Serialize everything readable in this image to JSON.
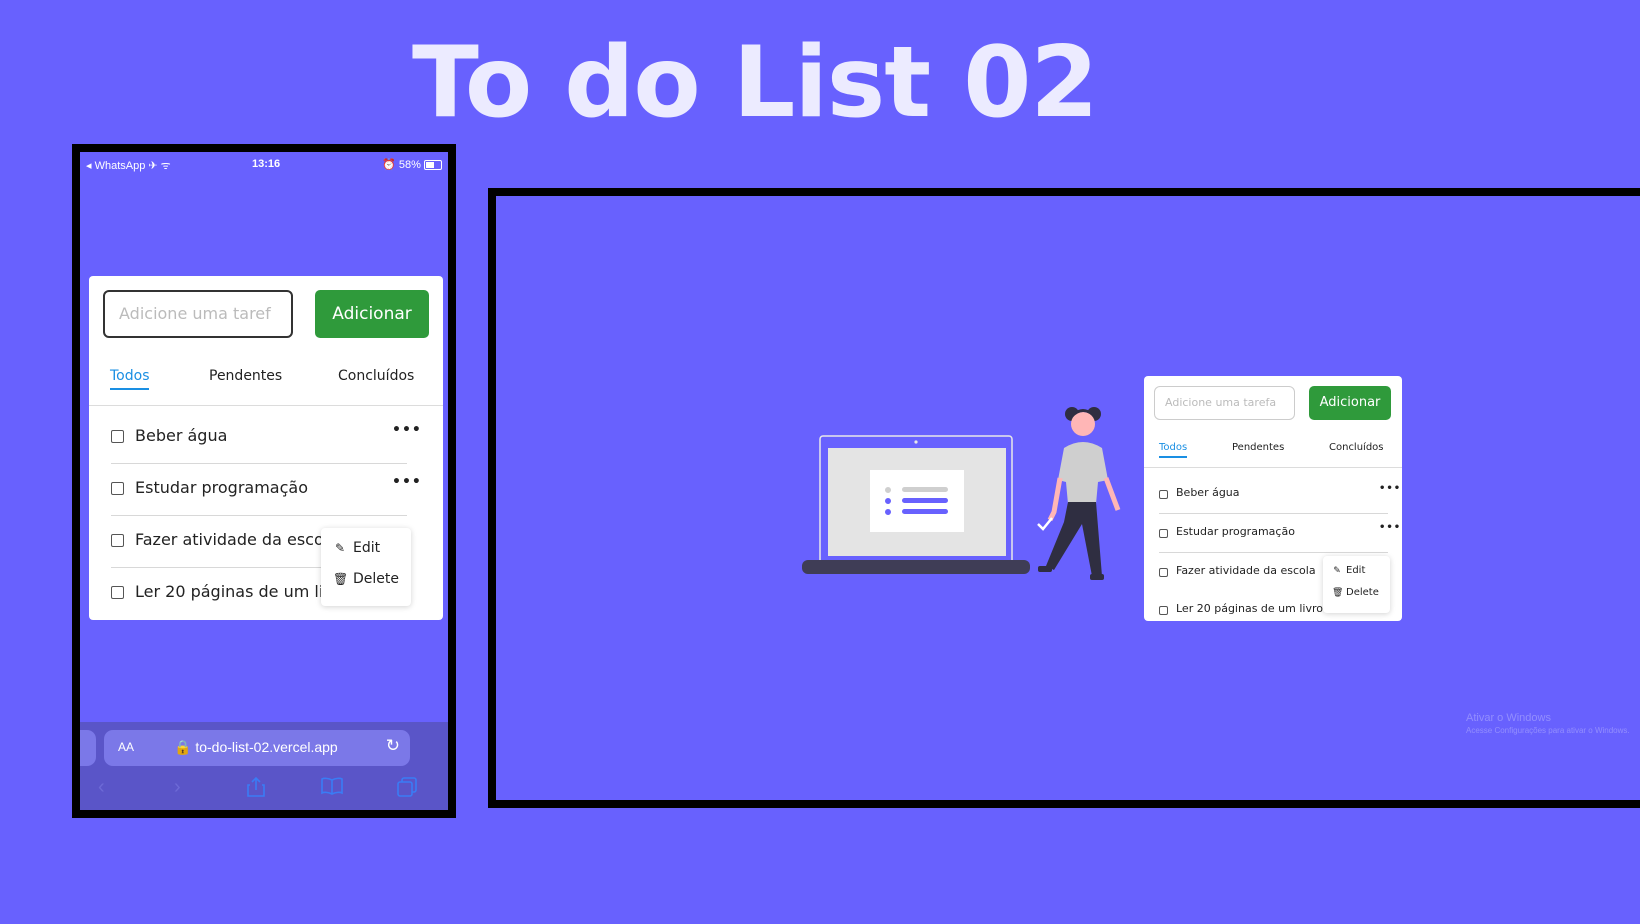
{
  "title": "To do List 02",
  "colors": {
    "background": "#6861fe",
    "add_button": "#2f9a3b",
    "active_tab": "#1a8fe3"
  },
  "phone": {
    "status": {
      "left": "◂ WhatsApp ✈ ᯤ",
      "time": "13:16",
      "battery": "⏰ 58%"
    },
    "app": {
      "input_placeholder": "Adicione uma taref",
      "add_label": "Adicionar",
      "tabs": [
        "Todos",
        "Pendentes",
        "Concluídos"
      ],
      "tasks": [
        "Beber água",
        "Estudar programação",
        "Fazer atividade da escola",
        "Ler 20 páginas de um livro"
      ],
      "menu": {
        "edit": "Edit",
        "delete": "Delete"
      }
    },
    "browser": {
      "aa": "AA",
      "url": "🔒 to-do-list-02.vercel.app",
      "reload_icon": "↻",
      "nav_icons": [
        "back-icon",
        "forward-icon",
        "share-icon",
        "bookmarks-icon",
        "tabs-icon"
      ]
    }
  },
  "desktop": {
    "app": {
      "input_placeholder": "Adicione uma tarefa",
      "add_label": "Adicionar",
      "tabs": [
        "Todos",
        "Pendentes",
        "Concluídos"
      ],
      "tasks": [
        "Beber água",
        "Estudar programação",
        "Fazer atividade da escola",
        "Ler 20 páginas de um livro"
      ],
      "menu": {
        "edit": "Edit",
        "delete": "Delete"
      }
    },
    "watermark": {
      "line1": "Ativar o Windows",
      "line2": "Acesse Configurações para ativar o Windows."
    }
  }
}
